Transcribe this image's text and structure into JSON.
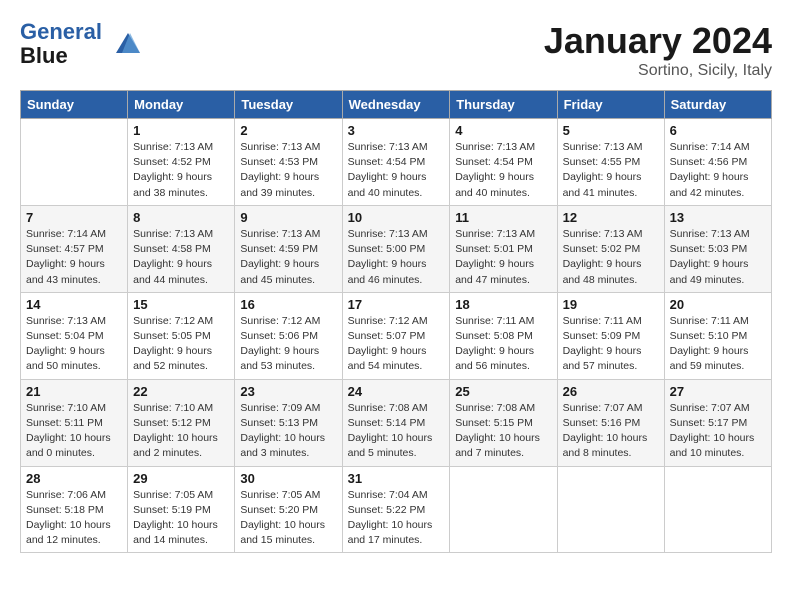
{
  "app": {
    "logo_line1": "General",
    "logo_line2": "Blue"
  },
  "calendar": {
    "month": "January 2024",
    "location": "Sortino, Sicily, Italy",
    "days_of_week": [
      "Sunday",
      "Monday",
      "Tuesday",
      "Wednesday",
      "Thursday",
      "Friday",
      "Saturday"
    ],
    "weeks": [
      [
        {
          "num": "",
          "info": ""
        },
        {
          "num": "1",
          "info": "Sunrise: 7:13 AM\nSunset: 4:52 PM\nDaylight: 9 hours\nand 38 minutes."
        },
        {
          "num": "2",
          "info": "Sunrise: 7:13 AM\nSunset: 4:53 PM\nDaylight: 9 hours\nand 39 minutes."
        },
        {
          "num": "3",
          "info": "Sunrise: 7:13 AM\nSunset: 4:54 PM\nDaylight: 9 hours\nand 40 minutes."
        },
        {
          "num": "4",
          "info": "Sunrise: 7:13 AM\nSunset: 4:54 PM\nDaylight: 9 hours\nand 40 minutes."
        },
        {
          "num": "5",
          "info": "Sunrise: 7:13 AM\nSunset: 4:55 PM\nDaylight: 9 hours\nand 41 minutes."
        },
        {
          "num": "6",
          "info": "Sunrise: 7:14 AM\nSunset: 4:56 PM\nDaylight: 9 hours\nand 42 minutes."
        }
      ],
      [
        {
          "num": "7",
          "info": "Sunrise: 7:14 AM\nSunset: 4:57 PM\nDaylight: 9 hours\nand 43 minutes."
        },
        {
          "num": "8",
          "info": "Sunrise: 7:13 AM\nSunset: 4:58 PM\nDaylight: 9 hours\nand 44 minutes."
        },
        {
          "num": "9",
          "info": "Sunrise: 7:13 AM\nSunset: 4:59 PM\nDaylight: 9 hours\nand 45 minutes."
        },
        {
          "num": "10",
          "info": "Sunrise: 7:13 AM\nSunset: 5:00 PM\nDaylight: 9 hours\nand 46 minutes."
        },
        {
          "num": "11",
          "info": "Sunrise: 7:13 AM\nSunset: 5:01 PM\nDaylight: 9 hours\nand 47 minutes."
        },
        {
          "num": "12",
          "info": "Sunrise: 7:13 AM\nSunset: 5:02 PM\nDaylight: 9 hours\nand 48 minutes."
        },
        {
          "num": "13",
          "info": "Sunrise: 7:13 AM\nSunset: 5:03 PM\nDaylight: 9 hours\nand 49 minutes."
        }
      ],
      [
        {
          "num": "14",
          "info": "Sunrise: 7:13 AM\nSunset: 5:04 PM\nDaylight: 9 hours\nand 50 minutes."
        },
        {
          "num": "15",
          "info": "Sunrise: 7:12 AM\nSunset: 5:05 PM\nDaylight: 9 hours\nand 52 minutes."
        },
        {
          "num": "16",
          "info": "Sunrise: 7:12 AM\nSunset: 5:06 PM\nDaylight: 9 hours\nand 53 minutes."
        },
        {
          "num": "17",
          "info": "Sunrise: 7:12 AM\nSunset: 5:07 PM\nDaylight: 9 hours\nand 54 minutes."
        },
        {
          "num": "18",
          "info": "Sunrise: 7:11 AM\nSunset: 5:08 PM\nDaylight: 9 hours\nand 56 minutes."
        },
        {
          "num": "19",
          "info": "Sunrise: 7:11 AM\nSunset: 5:09 PM\nDaylight: 9 hours\nand 57 minutes."
        },
        {
          "num": "20",
          "info": "Sunrise: 7:11 AM\nSunset: 5:10 PM\nDaylight: 9 hours\nand 59 minutes."
        }
      ],
      [
        {
          "num": "21",
          "info": "Sunrise: 7:10 AM\nSunset: 5:11 PM\nDaylight: 10 hours\nand 0 minutes."
        },
        {
          "num": "22",
          "info": "Sunrise: 7:10 AM\nSunset: 5:12 PM\nDaylight: 10 hours\nand 2 minutes."
        },
        {
          "num": "23",
          "info": "Sunrise: 7:09 AM\nSunset: 5:13 PM\nDaylight: 10 hours\nand 3 minutes."
        },
        {
          "num": "24",
          "info": "Sunrise: 7:08 AM\nSunset: 5:14 PM\nDaylight: 10 hours\nand 5 minutes."
        },
        {
          "num": "25",
          "info": "Sunrise: 7:08 AM\nSunset: 5:15 PM\nDaylight: 10 hours\nand 7 minutes."
        },
        {
          "num": "26",
          "info": "Sunrise: 7:07 AM\nSunset: 5:16 PM\nDaylight: 10 hours\nand 8 minutes."
        },
        {
          "num": "27",
          "info": "Sunrise: 7:07 AM\nSunset: 5:17 PM\nDaylight: 10 hours\nand 10 minutes."
        }
      ],
      [
        {
          "num": "28",
          "info": "Sunrise: 7:06 AM\nSunset: 5:18 PM\nDaylight: 10 hours\nand 12 minutes."
        },
        {
          "num": "29",
          "info": "Sunrise: 7:05 AM\nSunset: 5:19 PM\nDaylight: 10 hours\nand 14 minutes."
        },
        {
          "num": "30",
          "info": "Sunrise: 7:05 AM\nSunset: 5:20 PM\nDaylight: 10 hours\nand 15 minutes."
        },
        {
          "num": "31",
          "info": "Sunrise: 7:04 AM\nSunset: 5:22 PM\nDaylight: 10 hours\nand 17 minutes."
        },
        {
          "num": "",
          "info": ""
        },
        {
          "num": "",
          "info": ""
        },
        {
          "num": "",
          "info": ""
        }
      ]
    ]
  }
}
